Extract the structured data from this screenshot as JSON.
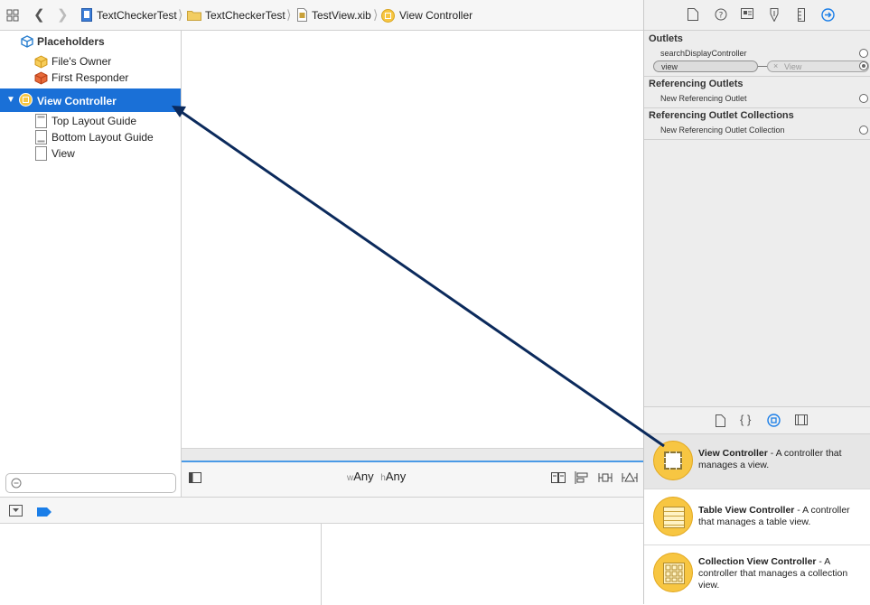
{
  "breadcrumb": {
    "items": [
      "TextCheckerTest",
      "TextCheckerTest",
      "TestView.xib",
      "View Controller"
    ]
  },
  "outline": {
    "placeholders_header": "Placeholders",
    "files_owner": "File's Owner",
    "first_responder": "First Responder",
    "view_controller": "View Controller",
    "children": [
      "Top Layout Guide",
      "Bottom Layout Guide",
      "View"
    ]
  },
  "canvas": {
    "size_class_w_prefix": "w",
    "size_class_w": "Any",
    "size_class_h_prefix": "h",
    "size_class_h": "Any"
  },
  "inspector": {
    "outlets_title": "Outlets",
    "outlets": [
      {
        "name": "searchDisplayController"
      },
      {
        "name": "view",
        "connected_to": "View"
      }
    ],
    "referencing_outlets_title": "Referencing Outlets",
    "new_referencing_outlet": "New Referencing Outlet",
    "referencing_collections_title": "Referencing Outlet Collections",
    "new_referencing_collection": "New Referencing Outlet Collection"
  },
  "library": {
    "items": [
      {
        "title": "View Controller",
        "desc": " - A controller that manages a view."
      },
      {
        "title": "Table View Controller",
        "desc": " - A controller that manages a table view."
      },
      {
        "title": "Collection View Controller",
        "desc": " - A controller that manages a collection view."
      }
    ]
  },
  "colors": {
    "selection": "#1a70d7",
    "arrow": "#0b2a5c",
    "accent_icon": "#f7c642"
  }
}
